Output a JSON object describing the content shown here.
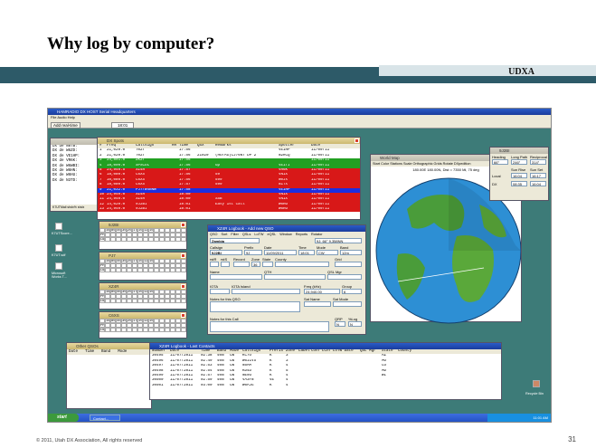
{
  "slide": {
    "title": "Why log by computer?",
    "band_label": "UDXA",
    "footer": "© 2011,  Utah  DX  Association,   All  rights  reserved",
    "page_number": "31"
  },
  "app": {
    "title": "HAMRADIO DX HOST Serial Headquarters",
    "menu": "File  Audio  Help",
    "add_button": "Add real-time",
    "time": "18:01"
  },
  "spots_left": [
    "DX de N8TB:",
    "DX de W6ZD:",
    "DX de VE1HP:",
    "DX de VR6K:",
    "DX de W6WBI:",
    "DX de W6HN:",
    "DX de W6HU:",
    "DX de N3TD:"
  ],
  "clusters": {
    "header": [
      "#",
      "Freq",
      "Callsign",
      "HH",
      "Time",
      "QSX",
      "Remarks",
      "Spotter",
      "Date"
    ],
    "rows": [
      {
        "c": "1",
        "f": "21,020.0",
        "call": "T02T",
        "t": "17:56",
        "qsx": "",
        "rem": "",
        "sp": "VE1HP",
        "d": "11/09/11",
        "bg": "#fff",
        "fg": "#000"
      },
      {
        "c": "2",
        "f": "21,020.0",
        "call": "T02T",
        "t": "17:56",
        "qsx": "21020",
        "rem": "(HOTAG)CJ76NT DP 2",
        "sp": "N2RCQ",
        "d": "11/09/11",
        "bg": "#fff",
        "fg": "#000"
      },
      {
        "c": "3",
        "f": "24,891.0",
        "call": "ZK2T",
        "t": "17:56",
        "qsx": "",
        "rem": "",
        "sp": "",
        "d": "11/09/11",
        "bg": "#22a022",
        "fg": "#fff"
      },
      {
        "c": "4",
        "f": "18,090.0",
        "call": "SPSCOL",
        "t": "17:56",
        "qsx": "",
        "rem": "up",
        "sp": "VE1TI",
        "d": "11/09/11",
        "bg": "#22a022",
        "fg": "#fff"
      },
      {
        "c": "5",
        "f": "24,940.5",
        "call": "XZ4R",
        "t": "17:57",
        "qsx": "",
        "rem": "",
        "sp": "VR6K",
        "d": "11/09/11",
        "bg": "#d81818",
        "fg": "#fff"
      },
      {
        "c": "6",
        "f": "18,080.0",
        "call": "C6XS",
        "t": "17:56",
        "qsx": "",
        "rem": "59",
        "sp": "VN1X",
        "d": "11/09/11",
        "bg": "#d81818",
        "fg": "#fff"
      },
      {
        "c": "7",
        "f": "10,080.0",
        "call": "C6XS",
        "t": "17:56",
        "qsx": "",
        "rem": "599",
        "sp": "N0JX",
        "d": "11/09/11",
        "bg": "#d81818",
        "fg": "#fff"
      },
      {
        "c": "8",
        "f": "18,080.0",
        "call": "C6XS",
        "t": "17:57",
        "qsx": "",
        "rem": "599",
        "sp": "N1TX",
        "d": "11/09/11",
        "bg": "#d81818",
        "fg": "#fff"
      },
      {
        "c": "9",
        "f": "21,032.0",
        "call": "PJ7/W4BNW",
        "t": "17:58",
        "qsx": "",
        "rem": "",
        "sp": "VE1HP",
        "d": "11/09/11",
        "bg": "#1c2ee0",
        "fg": "#fff"
      },
      {
        "c": "10",
        "f": "24,940.0",
        "call": "XZ4R",
        "t": "18:00",
        "qsx": "",
        "rem": "",
        "sp": "VN1X",
        "d": "11/09/11",
        "bg": "#d81818",
        "fg": "#fff"
      },
      {
        "c": "11",
        "f": "24,940.0",
        "call": "XZ4R",
        "t": "18:00",
        "qsx": "",
        "rem": "SSB",
        "sp": "VN1X",
        "d": "11/09/11",
        "bg": "#d81818",
        "fg": "#fff"
      },
      {
        "c": "12",
        "f": "14,020.0",
        "call": "9J2BI",
        "t": "18:01",
        "qsx": "",
        "rem": "Easy 1st call",
        "sp": "W6HU",
        "d": "11/09/11",
        "bg": "#d81818",
        "fg": "#fff"
      },
      {
        "c": "13",
        "f": "24,940.0",
        "call": "9J2BI",
        "t": "18:01",
        "qsx": "",
        "rem": "",
        "sp": "W6HU",
        "d": "11/09/11",
        "bg": "#d81818",
        "fg": "#fff"
      }
    ]
  },
  "bandgrid": {
    "bands": [
      "160",
      "80",
      "40",
      "30",
      "20",
      "17",
      "15",
      "12",
      "10"
    ],
    "rows": [
      "PHN",
      "CW"
    ],
    "cw_marks": "C C C"
  },
  "qso": {
    "title": "XZ4R Logbook - Add new QSO",
    "menu": [
      "QSO",
      "Sort",
      "Filter",
      "QSLs",
      "LoTW",
      "eQSL",
      "Window",
      "Reports",
      "Rotator"
    ],
    "country": "Zambia",
    "coords": "9J: 66° 9,358NN",
    "callsign_label": "Callsign",
    "callsign": "9J2BI",
    "prefix_label": "Prefix",
    "prefix": "9J",
    "date_label": "Date",
    "date": "11/09/2011",
    "time_label": "Time",
    "time": "18:01",
    "mode_label": "Mode",
    "mode": "CW",
    "band_label": "Band",
    "band": "12m",
    "rstr_label": "rstR",
    "rsts_label": "rstS",
    "record_label": "Record",
    "zone_label": "Zone",
    "state_label": "State",
    "county_label": "County",
    "zone": "36",
    "grid_label": "Grid",
    "name_label": "Name",
    "qth_label": "QTH",
    "qslmgr_label": "QSL Mgr",
    "iota_label": "IOTA",
    "iotaisland_label": "IOTA Island",
    "freq_label": "Freq (kHz)",
    "freq": "24,940.00",
    "group_label": "Group",
    "group": "6",
    "notes_label": "Notes for this QSO",
    "satname_label": "Sat Name",
    "satmode_label": "Sat Mode",
    "notescall_label": "Notes for this Call",
    "qrp_label": "QRP",
    "qrp": "N",
    "pctlog_label": "%Log",
    "pctlog": "N"
  },
  "map": {
    "title": "World Map",
    "info": "180.00E 180.00N, Dist = 7350 Mi, 75 deg"
  },
  "sun": {
    "title": "9J2BI",
    "heading_label": "Heading",
    "heading": "66°",
    "longpath_label": "Long Path",
    "longpath": "246°",
    "recip_label": "Reciprocal",
    "recip": "314°",
    "sunrise_label": "Sun Rise",
    "sunset_label": "Sun Set",
    "local_label": "Local",
    "local": "16:04",
    "dx_label": "DX",
    "dx": "08:35",
    "sunrise": "16:04",
    "sunset": "16:17"
  },
  "log": {
    "title": "XZ4R Logbook - Last Contacts",
    "header": [
      "Number",
      "Date",
      "Time",
      "Band",
      "Mode",
      "Callsign",
      "Prefix",
      "Zone",
      "Label",
      "Conf",
      "LCnf",
      "LoTW Date",
      "QSL Mgr",
      "State",
      "County"
    ],
    "rows": [
      [
        "30495",
        "11/07/2011",
        "02:38",
        "40m",
        "CW",
        "KC7O",
        "K",
        "3",
        "",
        "",
        "",
        "",
        "",
        "AZ",
        ""
      ],
      [
        "30496",
        "11/07/2011",
        "02:49",
        "40m",
        "CW",
        "W6ILVS",
        "K",
        "3",
        "",
        "",
        "",
        "",
        "",
        "MO",
        ""
      ],
      [
        "30497",
        "11/07/2011",
        "02:53",
        "40m",
        "CW",
        "N5AM",
        "K",
        "4",
        "",
        "",
        "",
        "",
        "",
        "CO",
        ""
      ],
      [
        "30498",
        "11/07/2011",
        "02:54",
        "40m",
        "CW",
        "KD4D",
        "K",
        "5",
        "",
        "",
        "",
        "",
        "",
        "MD",
        ""
      ],
      [
        "30499",
        "11/07/2011",
        "02:57",
        "40m",
        "CW",
        "NE9U",
        "K",
        "4",
        "",
        "",
        "",
        "",
        "",
        "WI",
        ""
      ],
      [
        "30500",
        "11/07/2011",
        "02:59",
        "40m",
        "CW",
        "VA3FN",
        "VE",
        "4",
        "",
        "",
        "",
        "",
        "",
        "",
        ""
      ],
      [
        "30501",
        "11/07/2011",
        "03:00",
        "40m",
        "CW",
        "W6AJG",
        "K",
        "4",
        "",
        "",
        "",
        "",
        "",
        "",
        ""
      ]
    ]
  },
  "other_qsos": {
    "title": "Other QSOs",
    "header": [
      "Date",
      "Time",
      "Band",
      "Mode"
    ]
  },
  "desktop_icons": [
    "K7UTScore...",
    "K7UT.sdf",
    "Microsoft Works T...",
    "Recycle Bin"
  ],
  "taskbar": {
    "start": "start",
    "task": "Contact...",
    "clock": "11:01 AM"
  }
}
